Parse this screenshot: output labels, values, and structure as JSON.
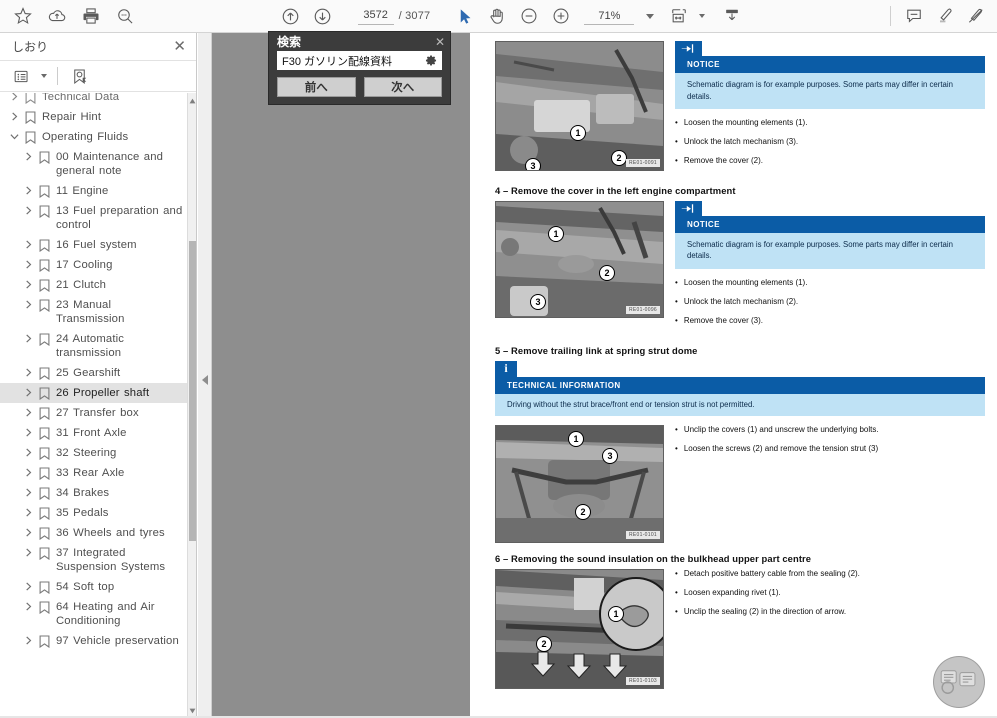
{
  "toolbar": {
    "left_icons": [
      {
        "name": "bookmark-star-icon",
        "label": "Add bookmark"
      },
      {
        "name": "cloud-upload-icon",
        "label": "Save to cloud"
      },
      {
        "name": "print-icon",
        "label": "Print"
      },
      {
        "name": "search-icon",
        "label": "Search"
      }
    ],
    "nav_icons": [
      {
        "name": "previous-page-icon",
        "label": "Previous page"
      },
      {
        "name": "next-page-icon",
        "label": "Next page"
      }
    ],
    "page_current": "3572",
    "page_total": "/ 3077",
    "tools": [
      {
        "name": "select-cursor-icon",
        "label": "Select tool"
      },
      {
        "name": "hand-tool-icon",
        "label": "Hand tool"
      },
      {
        "name": "zoom-out-icon",
        "label": "Zoom out"
      },
      {
        "name": "zoom-in-icon",
        "label": "Zoom in"
      }
    ],
    "zoom_value": "71%",
    "right_icons": [
      {
        "name": "fit-page-icon",
        "label": "Fit page"
      },
      {
        "name": "download-icon",
        "label": "Download"
      },
      {
        "name": "comment-icon",
        "label": "Add comment"
      },
      {
        "name": "highlight-pen-icon",
        "label": "Highlight"
      },
      {
        "name": "signature-icon",
        "label": "Sign"
      }
    ]
  },
  "sidebar": {
    "title": "しおり",
    "close_label": "✕",
    "tools": [
      {
        "name": "list-options-icon",
        "label": "Bookmark options"
      },
      {
        "name": "find-bookmark-icon",
        "label": "Find current bookmark"
      }
    ],
    "items": [
      {
        "label": "Technical Data",
        "level": 0,
        "expanded": false,
        "selected": false,
        "partial": true
      },
      {
        "label": "Repair Hint",
        "level": 0,
        "expanded": false,
        "selected": false
      },
      {
        "label": "Operating Fluids",
        "level": 0,
        "expanded": true,
        "selected": false
      },
      {
        "label": "00 Maintenance and general note",
        "level": 1,
        "expanded": false,
        "selected": false
      },
      {
        "label": "11  Engine",
        "level": 1,
        "expanded": false,
        "selected": false
      },
      {
        "label": "13 Fuel preparation and control",
        "level": 1,
        "expanded": false,
        "selected": false
      },
      {
        "label": "16 Fuel system",
        "level": 1,
        "expanded": false,
        "selected": false
      },
      {
        "label": "17 Cooling",
        "level": 1,
        "expanded": false,
        "selected": false
      },
      {
        "label": "21 Clutch",
        "level": 1,
        "expanded": false,
        "selected": false
      },
      {
        "label": "23 Manual Transmission",
        "level": 1,
        "expanded": false,
        "selected": false
      },
      {
        "label": "24  Automatic transmission",
        "level": 1,
        "expanded": false,
        "selected": false
      },
      {
        "label": "25 Gearshift",
        "level": 1,
        "expanded": false,
        "selected": false
      },
      {
        "label": "26  Propeller shaft",
        "level": 1,
        "expanded": false,
        "selected": true
      },
      {
        "label": "27  Transfer box",
        "level": 1,
        "expanded": false,
        "selected": false
      },
      {
        "label": "31  Front Axle",
        "level": 1,
        "expanded": false,
        "selected": false
      },
      {
        "label": "32 Steering",
        "level": 1,
        "expanded": false,
        "selected": false
      },
      {
        "label": "33 Rear Axle",
        "level": 1,
        "expanded": false,
        "selected": false
      },
      {
        "label": "34 Brakes",
        "level": 1,
        "expanded": false,
        "selected": false
      },
      {
        "label": "35 Pedals",
        "level": 1,
        "expanded": false,
        "selected": false
      },
      {
        "label": "36 Wheels and tyres",
        "level": 1,
        "expanded": false,
        "selected": false
      },
      {
        "label": "37 Integrated Suspension Systems",
        "level": 1,
        "expanded": false,
        "selected": false
      },
      {
        "label": "54 Soft top",
        "level": 1,
        "expanded": false,
        "selected": false
      },
      {
        "label": "64 Heating and Air Conditioning",
        "level": 1,
        "expanded": false,
        "selected": false
      },
      {
        "label": "97  Vehicle preservation",
        "level": 1,
        "expanded": false,
        "selected": false
      }
    ]
  },
  "search_dialog": {
    "title": "検索",
    "close_label": "✕",
    "query": "F30 ガソリン配線資料",
    "gear_icon": "settings-gear-icon",
    "prev_label": "前へ",
    "next_label": "次へ"
  },
  "document": {
    "sections": [
      {
        "id": "section-3-continued",
        "heading": "",
        "box_type": "notice",
        "box_title": "NOTICE",
        "box_text": "Schematic diagram is for example purposes. Some parts may differ in certain details.",
        "bullets": [
          "Loosen the mounting elements (1).",
          "Unlock the latch mechanism (3).",
          "Remove the cover (2)."
        ],
        "photo_callouts": [
          "1",
          "2",
          "3"
        ],
        "photo_watermark": "RE01-0091"
      },
      {
        "id": "section-4",
        "heading": "4 – Remove the cover in the left engine compartment",
        "box_type": "notice",
        "box_title": "NOTICE",
        "box_text": "Schematic diagram is for example purposes. Some parts may differ in certain details.",
        "bullets": [
          "Loosen the mounting elements (1).",
          "Unlock the latch mechanism (2).",
          "Remove the cover (3)."
        ],
        "photo_callouts": [
          "1",
          "2",
          "3"
        ],
        "photo_watermark": "RE01-0096"
      },
      {
        "id": "section-5",
        "heading": "5 – Remove trailing link at spring strut dome",
        "box_type": "technical",
        "box_title": "TECHNICAL INFORMATION",
        "box_text": "Driving without the strut brace/front end or tension strut is not permitted.",
        "bullets": [
          "Unclip the covers (1) and unscrew the underlying bolts.",
          "Loosen the screws (2) and remove the tension strut (3)"
        ],
        "photo_callouts": [
          "1",
          "2",
          "3"
        ],
        "photo_watermark": "RE01-0101"
      },
      {
        "id": "section-6",
        "heading": "6 – Removing the sound insulation on the bulkhead upper part centre",
        "box_type": "none",
        "box_title": "",
        "box_text": "",
        "bullets": [
          "Detach positive battery cable from the sealing (2).",
          "Loosen expanding rivet (1).",
          "Unclip the sealing (2) in the direction of arrow."
        ],
        "photo_callouts": [
          "1",
          "2"
        ],
        "photo_watermark": "RE01-0103"
      }
    ],
    "watermark_logo": "circular-logo-watermark"
  },
  "colors": {
    "accent_blue": "#0b5ca6",
    "notice_body": "#bfe2f5",
    "selection_grey": "#e2e2e2",
    "mid_pane_grey": "#8e8e8e"
  }
}
